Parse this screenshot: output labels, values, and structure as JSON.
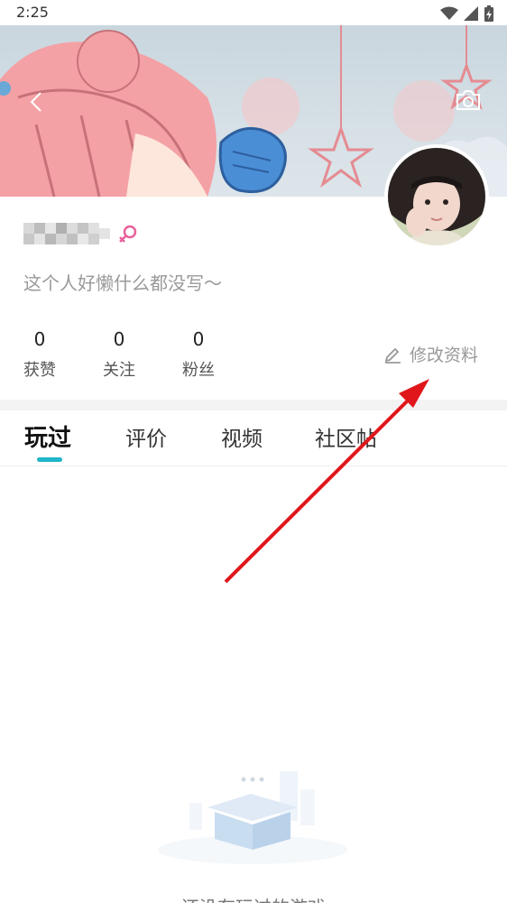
{
  "status_bar": {
    "time": "2:25"
  },
  "profile": {
    "bio": "这个人好懒什么都没写～",
    "stats": [
      {
        "value": "0",
        "label": "获赞"
      },
      {
        "value": "0",
        "label": "关注"
      },
      {
        "value": "0",
        "label": "粉丝"
      }
    ],
    "edit_label": "修改资料"
  },
  "tabs": [
    {
      "label": "玩过"
    },
    {
      "label": "评价"
    },
    {
      "label": "视频"
    },
    {
      "label": "社区帖"
    }
  ],
  "empty_state": {
    "message": "还没有玩过的游戏"
  },
  "colors": {
    "accent": "#1fb6c8",
    "gender_pink": "#e8609a",
    "annotation_red": "#e0161b"
  }
}
